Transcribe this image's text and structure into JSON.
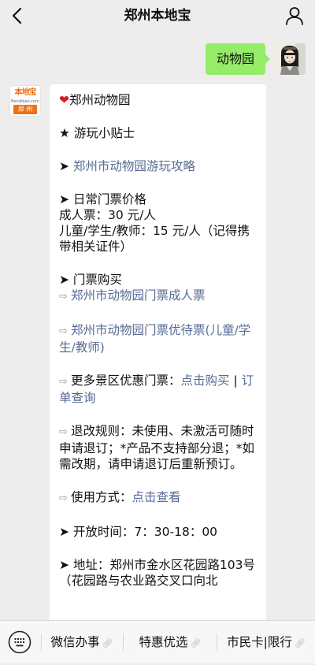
{
  "navbar": {
    "title": "郑州本地宝",
    "back_icon": "chevron-left-icon",
    "profile_icon": "person-icon"
  },
  "user_message": {
    "text": "动物园"
  },
  "bot_avatar": {
    "logo_text": "本地宝",
    "logo_domain": "Bendibao.com",
    "city_label": "郑 州"
  },
  "bot_message": {
    "title": "郑州动物园",
    "tips_heading": "★ 游玩小贴士",
    "guide_link": "郑州市动物园游玩攻略",
    "price_heading": "日常门票价格",
    "adult_price": "成人票：30 元/人",
    "child_price": "儿童/学生/教师：15 元/人（记得携带相关证件）",
    "buy_heading": "门票购买",
    "adult_ticket_link": "郑州市动物园门票成人票",
    "discount_ticket_link": "郑州市动物园门票优待票(儿童/学生/教师)",
    "more_label": "更多景区优惠门票：",
    "buy_link": "点击购买",
    "separator": " | ",
    "order_link": "订单查询",
    "refund_label": "退改规则：",
    "refund_text": "未使用、未激活可随时申请退订；*产品不支持部分退；*如需改期，请申请退订后重新预订。",
    "usage_label": "使用方式：",
    "usage_link": "点击查看",
    "hours": "开放时间：7：30-18：00",
    "address": "地址：郑州市金水区花园路103号（花园路与农业路交叉口向北"
  },
  "bottom_menu": {
    "keyboard_icon": "keyboard-icon",
    "items": [
      {
        "label": "微信办事",
        "icon": "link-icon"
      },
      {
        "label": "特惠优选",
        "icon": "link-icon"
      },
      {
        "label": "市民卡|限行",
        "icon": "link-icon"
      }
    ]
  },
  "colors": {
    "link": "#576b95",
    "user_bubble": "#95ec69",
    "background": "#ededed",
    "heart": "#e0191c",
    "brand_orange": "#e8731a"
  }
}
